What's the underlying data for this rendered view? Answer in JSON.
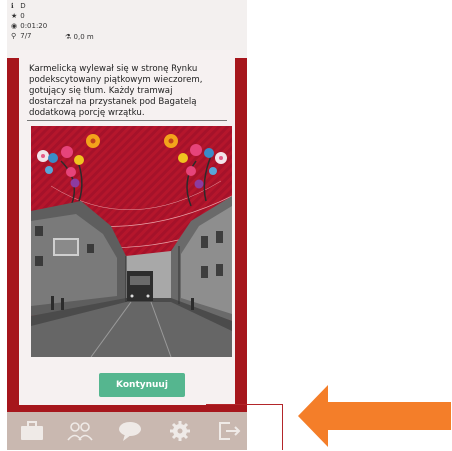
{
  "status": {
    "location_value": "D",
    "stars_value": "0",
    "timer_value": "0:01:20",
    "trophy_value": "7/7",
    "distance_value": "0,0 m"
  },
  "story": {
    "text": "Karmelicką wylewał się w stronę Rynku\npodekscytowany piątkowym wieczorem,\ngotujący się tłum. Każdy tramwaj\ndostarczał na przystanek pod Bagatelą\ndodatkową porcję wrzątku."
  },
  "buttons": {
    "continue_label": "Kontynuuj"
  },
  "bottom_nav": {
    "items": [
      "briefcase-icon",
      "team-icon",
      "chat-icon",
      "settings-gear-icon",
      "exit-icon"
    ]
  },
  "colors": {
    "background_red": "#a6161c",
    "continue_green": "#55b68f",
    "bottom_bar": "#c9b8b0",
    "arrow_orange": "#f47e29"
  }
}
